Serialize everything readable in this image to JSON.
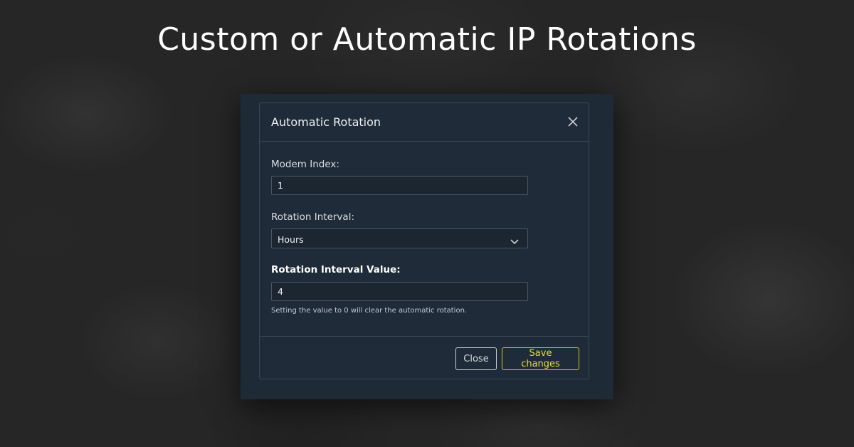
{
  "headline": "Custom or Automatic IP Rotations",
  "modal": {
    "title": "Automatic Rotation",
    "close_icon": "close-icon",
    "fields": {
      "modem_index_label": "Modem Index:",
      "modem_index_value": "1",
      "rotation_interval_label": "Rotation Interval:",
      "rotation_interval_value": "Hours",
      "rotation_interval_value_label": "Rotation Interval Value:",
      "rotation_interval_value_value": "4",
      "help_text": "Setting the value to 0 will clear the automatic rotation."
    },
    "footer": {
      "close_label": "Close",
      "save_label": "Save changes"
    }
  },
  "colors": {
    "accent": "#cfc72a",
    "modal_bg": "#1f2b38",
    "page_bg": "#262626"
  }
}
